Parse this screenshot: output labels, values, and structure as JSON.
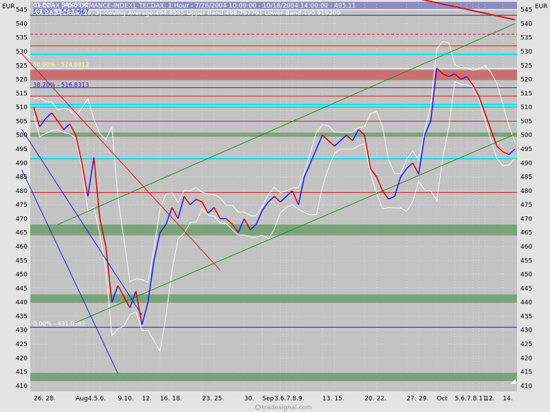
{
  "currency_left": "EUR",
  "currency_right": "EUR",
  "header_line1": "TECDAX [PERFORMANCE-INDEX], TECDAX, 1 Hour - 7/26/2004 10:00:00 - 10/18/2004 14:00:00 - 495.11",
  "header_line2": "XX BBD [Close, 20, 2] Moving Average:494.8585 Upper Band:498.797791 Lower Band:490.919209",
  "watermark": "tradesignal.com",
  "colors": {
    "plot_bg": "#c3c3c3",
    "up_bar": "#1a1aff",
    "down_bar": "#e00000",
    "bands": "#ffffff",
    "channel": "#1e8a1e",
    "downtrend": "#0000cc",
    "zone_red": "#c86464",
    "zone_green": "#6e9e6e",
    "cyan_level": "#00e5ee"
  },
  "chart_data": {
    "type": "line",
    "title": "TECDAX [PERFORMANCE-INDEX], TECDAX, 1 Hour",
    "ylabel": "EUR",
    "ylim": [
      408,
      548
    ],
    "y_ticks": [
      410,
      415,
      420,
      425,
      430,
      435,
      440,
      445,
      450,
      455,
      460,
      465,
      470,
      475,
      480,
      485,
      490,
      495,
      500,
      505,
      510,
      515,
      520,
      525,
      530,
      535,
      540,
      545
    ],
    "x_labels": [
      {
        "d": 0,
        "t": "26."
      },
      {
        "d": 2,
        "t": "28."
      },
      {
        "d": 7,
        "t": "Aug"
      },
      {
        "d": 9,
        "t": "4."
      },
      {
        "d": 10,
        "t": "5."
      },
      {
        "d": 11,
        "t": "6."
      },
      {
        "d": 14,
        "t": "9."
      },
      {
        "d": 15,
        "t": "10."
      },
      {
        "d": 18,
        "t": "12."
      },
      {
        "d": 21,
        "t": "16."
      },
      {
        "d": 23,
        "t": "18."
      },
      {
        "d": 28,
        "t": "23."
      },
      {
        "d": 30,
        "t": "25."
      },
      {
        "d": 35,
        "t": "30."
      },
      {
        "d": 38,
        "t": "Sep"
      },
      {
        "d": 40,
        "t": "3."
      },
      {
        "d": 41,
        "t": "6."
      },
      {
        "d": 42,
        "t": "7."
      },
      {
        "d": 43,
        "t": "8."
      },
      {
        "d": 44,
        "t": "9."
      },
      {
        "d": 48,
        "t": "13."
      },
      {
        "d": 50,
        "t": "15."
      },
      {
        "d": 55,
        "t": "20."
      },
      {
        "d": 57,
        "t": "22."
      },
      {
        "d": 62,
        "t": "27."
      },
      {
        "d": 64,
        "t": "29."
      },
      {
        "d": 67,
        "t": "Oct"
      },
      {
        "d": 70,
        "t": "5."
      },
      {
        "d": 71,
        "t": "6."
      },
      {
        "d": 72,
        "t": "7."
      },
      {
        "d": 73,
        "t": "8."
      },
      {
        "d": 74,
        "t": "11."
      },
      {
        "d": 75,
        "t": "12."
      },
      {
        "d": 78,
        "t": "14."
      }
    ],
    "x_start": "2004-07-26",
    "x_end": "2004-10-18",
    "series": [
      {
        "name": "TECDAX",
        "type": "line",
        "x": [
          0,
          1,
          2,
          3,
          4,
          5,
          6,
          7,
          8,
          9,
          10,
          11,
          12,
          13,
          14,
          15,
          16,
          17,
          18,
          19,
          20,
          21,
          22,
          23,
          24,
          25,
          26,
          27,
          28,
          29,
          30,
          31,
          32,
          33,
          34,
          35,
          36,
          37,
          38,
          39,
          40,
          41,
          42,
          43,
          44,
          45,
          46,
          47,
          48,
          49,
          50,
          51,
          52,
          53,
          54,
          55,
          56,
          57,
          58,
          59,
          60,
          61,
          62,
          63,
          64,
          65,
          66,
          67,
          68,
          69,
          70,
          71,
          72,
          73,
          74,
          75,
          76,
          77,
          78,
          79,
          80
        ],
        "y": [
          510,
          503,
          506,
          508,
          505,
          502,
          504,
          500,
          490,
          478,
          492,
          470,
          460,
          440,
          446,
          442,
          438,
          444,
          432,
          440,
          455,
          465,
          468,
          474,
          470,
          478,
          475,
          477,
          476,
          472,
          474,
          470,
          470,
          468,
          465,
          470,
          466,
          468,
          473,
          476,
          478,
          476,
          478,
          480,
          475,
          485,
          490,
          495,
          500,
          498,
          496,
          498,
          500,
          498,
          502,
          500,
          488,
          485,
          480,
          477,
          478,
          485,
          488,
          490,
          486,
          500,
          505,
          524,
          522,
          521,
          522,
          520,
          521,
          518,
          514,
          508,
          502,
          496,
          494,
          493,
          495
        ]
      }
    ],
    "bollinger": {
      "name": "XX BBD",
      "period": 20,
      "deviations": 2,
      "moving_average_last": 494.8585,
      "upper_band_last": 498.797791,
      "lower_band_last": 490.919209
    },
    "fibonacci": [
      {
        "label": "61.80% - 545.5592",
        "value": 545.5592
      },
      {
        "label": "50.00% - 543.0667",
        "value": 543.0667
      },
      {
        "label": "50.00% - 524.0812",
        "value": 524.0812
      },
      {
        "label": "38.20% - 516.8313",
        "value": 516.8313
      },
      {
        "label": "0.00% - 431.0383",
        "value": 431.0383
      }
    ],
    "horizontal_levels": [
      {
        "value": 545.0,
        "color": "white"
      },
      {
        "value": 543.0,
        "color": "blue"
      },
      {
        "value": 536.2,
        "color": "red-dashed"
      },
      {
        "value": 532.0,
        "color": "red"
      },
      {
        "value": 529.0,
        "color": "cyan"
      },
      {
        "value": 524.0,
        "color": "white"
      },
      {
        "value": 517.0,
        "color": "blue"
      },
      {
        "value": 514.0,
        "color": "red"
      },
      {
        "value": 511.0,
        "color": "cyan"
      },
      {
        "value": 510.0,
        "color": "cyan"
      },
      {
        "value": 505.0,
        "color": "red"
      },
      {
        "value": 491.5,
        "color": "cyan"
      },
      {
        "value": 479.4,
        "color": "red"
      },
      {
        "value": 476.2,
        "color": "yellow-dashed"
      },
      {
        "value": 431.0,
        "color": "blue"
      }
    ],
    "zones": [
      {
        "from": 519.7,
        "to": 523.4,
        "color": "red"
      },
      {
        "from": 499.4,
        "to": 500.9,
        "color": "green"
      },
      {
        "from": 464.0,
        "to": 467.9,
        "color": "green"
      },
      {
        "from": 439.8,
        "to": 442.8,
        "color": "green"
      },
      {
        "from": 411.7,
        "to": 414.7,
        "color": "green"
      }
    ],
    "trendlines": [
      {
        "name": "red-resistance",
        "from": [
          60,
          550.8
        ],
        "to": [
          80,
          541.4
        ],
        "color": "red"
      },
      {
        "name": "channel-upper",
        "from": [
          4,
          467.9
        ],
        "to": [
          80,
          540.0
        ],
        "color": "green"
      },
      {
        "name": "channel-lower",
        "from": [
          7,
          432.7
        ],
        "to": [
          80,
          500.3
        ],
        "color": "green"
      },
      {
        "name": "downtrend-upper",
        "from": [
          -2,
          529.2
        ],
        "to": [
          31,
          451.5
        ],
        "color": "red"
      },
      {
        "name": "downtrend-mid",
        "from": [
          -2,
          502.1
        ],
        "to": [
          18,
          435.4
        ],
        "color": "blue"
      },
      {
        "name": "downtrend-low",
        "from": [
          -2,
          487.6
        ],
        "to": [
          14,
          414.4
        ],
        "color": "blue"
      }
    ]
  }
}
